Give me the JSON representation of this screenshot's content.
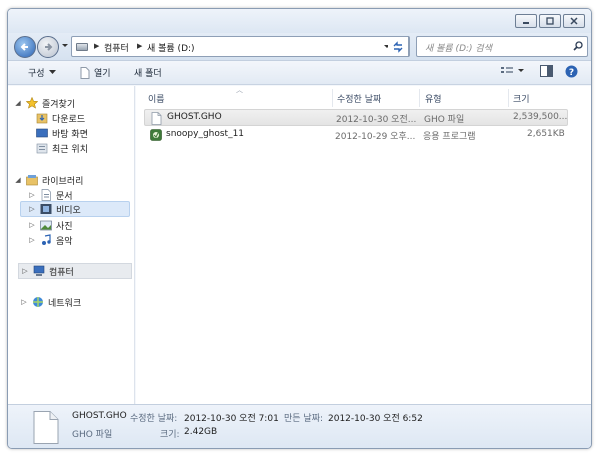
{
  "address": {
    "crumbs": [
      "컴퓨터",
      "새 볼륨 (D:)"
    ]
  },
  "search": {
    "placeholder": "새 볼륨 (D:) 검색"
  },
  "toolbar": {
    "organize_label": "구성",
    "open_label": "열기",
    "new_folder_label": "새 폴더"
  },
  "navpane": {
    "favorites_label": "즐겨찾기",
    "downloads_label": "다운로드",
    "desktop_label": "바탕 화면",
    "recent_label": "최근 위치",
    "libraries_label": "라이브러리",
    "documents_label": "문서",
    "videos_label": "비디오",
    "pictures_label": "사진",
    "music_label": "음악",
    "computer_label": "컴퓨터",
    "network_label": "네트워크"
  },
  "columns": {
    "name": "이름",
    "date": "수정한 날짜",
    "type": "유형",
    "size": "크기"
  },
  "files": [
    {
      "name": "GHOST.GHO",
      "date": "2012-10-30 오전...",
      "type": "GHO 파일",
      "size": "2,539,500..."
    },
    {
      "name": "snoopy_ghost_11",
      "date": "2012-10-29 오후...",
      "type": "응용 프로그램",
      "size": "2,651KB"
    }
  ],
  "details": {
    "filename": "GHOST.GHO",
    "filetype": "GHO 파일",
    "modified_label": "수정한 날짜:",
    "modified_value": "2012-10-30 오전 7:01",
    "created_label": "만든 날짜:",
    "created_value": "2012-10-30 오전 6:52",
    "size_label": "크기:",
    "size_value": "2.42GB"
  },
  "colors": {
    "accent": "#2c63b4",
    "selected_row": "#e4e4e4",
    "nav_selected": "#dce9f9"
  }
}
